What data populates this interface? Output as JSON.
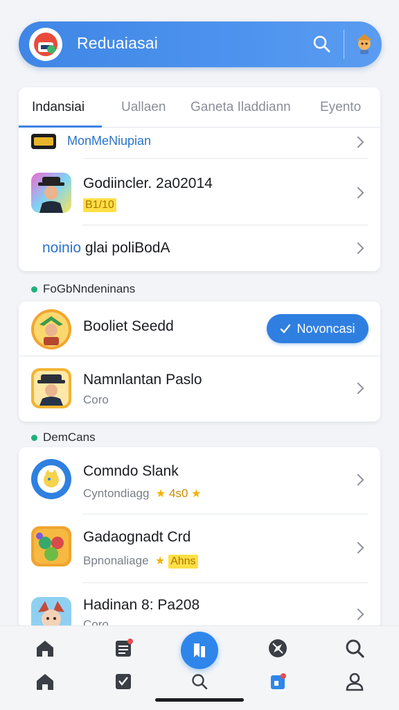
{
  "header": {
    "title": "Reduaiasai",
    "search_icon": "search-icon",
    "avatar_icon": "character-avatar-icon"
  },
  "tabs": [
    {
      "label": "Indansiai",
      "active": true
    },
    {
      "label": "Uallaen",
      "active": false
    },
    {
      "label": "Ganeta Iladdiann",
      "active": false
    },
    {
      "label": "Eyento",
      "active": false
    }
  ],
  "top_list": {
    "rows": [
      {
        "title": "MonMeNiupian"
      },
      {
        "title": "Godiincler. 2a02014",
        "sub": "B1/10"
      },
      {
        "title_blue": "noinio",
        "title_rest": " glai poliBodA"
      }
    ]
  },
  "section1": {
    "label": "FoGbNndeninans",
    "rows": [
      {
        "title": "Booliet Seedd",
        "button": "Novoncasi"
      },
      {
        "title": "Namnlantan Paslo",
        "sub": "Coro"
      }
    ]
  },
  "section2": {
    "label": "DemCans",
    "rows": [
      {
        "title": "Comndo Slank",
        "sub": "Cyntondiagg",
        "rating": "4s0"
      },
      {
        "title": "Gadaognadt Crd",
        "sub": "Bpnonaliage",
        "rating": "Ahns"
      },
      {
        "title": "Hadinan 8: Pa208",
        "sub": "Coro"
      }
    ]
  },
  "colors": {
    "accent": "#3f86e6",
    "green_dot": "#22b07d",
    "rating_yellow": "#ffe046"
  }
}
